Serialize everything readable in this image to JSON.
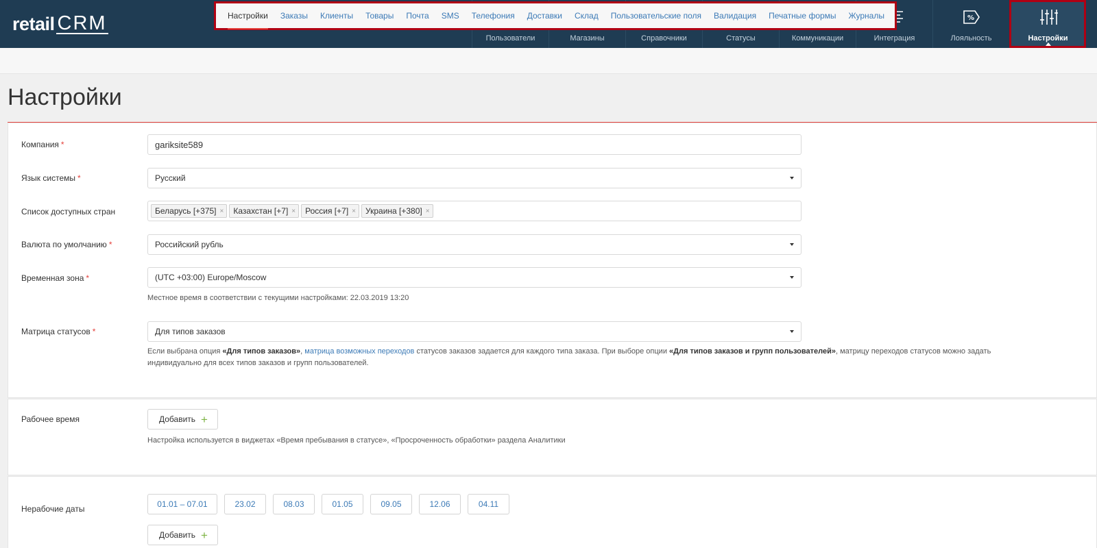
{
  "logo": {
    "retail": "retail",
    "crm": "CRM"
  },
  "nav": [
    {
      "label": "Пользователи",
      "icon": "user-icon"
    },
    {
      "label": "Магазины",
      "icon": "store-icon"
    },
    {
      "label": "Справочники",
      "icon": "reference-book-icon"
    },
    {
      "label": "Статусы",
      "icon": "status-grid-icon"
    },
    {
      "label": "Коммуникации",
      "icon": "mail-icon"
    },
    {
      "label": "Интеграция",
      "icon": "integration-icon"
    },
    {
      "label": "Лояльность",
      "icon": "percent-tag-icon"
    },
    {
      "label": "Настройки",
      "icon": "sliders-icon",
      "active": true
    }
  ],
  "subnav": [
    {
      "label": "Настройки",
      "active": true
    },
    {
      "label": "Заказы"
    },
    {
      "label": "Клиенты"
    },
    {
      "label": "Товары"
    },
    {
      "label": "Почта"
    },
    {
      "label": "SMS"
    },
    {
      "label": "Телефония"
    },
    {
      "label": "Доставки"
    },
    {
      "label": "Склад"
    },
    {
      "label": "Пользовательские поля"
    },
    {
      "label": "Валидация"
    },
    {
      "label": "Печатные формы"
    },
    {
      "label": "Журналы"
    }
  ],
  "page": {
    "title": "Настройки"
  },
  "form": {
    "company": {
      "label": "Компания",
      "value": "gariksite589"
    },
    "language": {
      "label": "Язык системы",
      "value": "Русский"
    },
    "countries": {
      "label": "Список доступных стран",
      "tags": [
        "Беларусь [+375]",
        "Казахстан [+7]",
        "Россия [+7]",
        "Украина [+380]"
      ],
      "remove_glyph": "×"
    },
    "currency": {
      "label": "Валюта по умолчанию",
      "value": "Российский рубль"
    },
    "timezone": {
      "label": "Временная зона",
      "value": "(UTC +03:00) Europe/Moscow",
      "hint": "Местное время в соответствии с текущими настройками: 22.03.2019 13:20"
    },
    "status_matrix": {
      "label": "Матрица статусов",
      "value": "Для типов заказов",
      "hint_part1": "Если выбрана опция ",
      "hint_bold1": "«Для типов заказов»",
      "hint_part2": ", ",
      "hint_link": "матрица возможных переходов",
      "hint_part3": " статусов заказов задается для каждого типа заказа. При выборе опции ",
      "hint_bold2": "«Для типов заказов и групп пользователей»",
      "hint_part4": ", матрицу переходов статусов можно задать индивидуально для всех типов заказов и групп пользователей."
    },
    "required_mark": "*"
  },
  "working_time": {
    "label": "Рабочее время",
    "add_label": "Добавить",
    "hint": "Настройка используется в виджетах «Время пребывания в статусе», «Просроченность обработки» раздела Аналитики"
  },
  "non_working": {
    "label": "Нерабочие даты",
    "dates": [
      "01.01 – 07.01",
      "23.02",
      "08.03",
      "01.05",
      "09.05",
      "12.06",
      "04.11"
    ],
    "add_label": "Добавить"
  },
  "plus_glyph": "+"
}
